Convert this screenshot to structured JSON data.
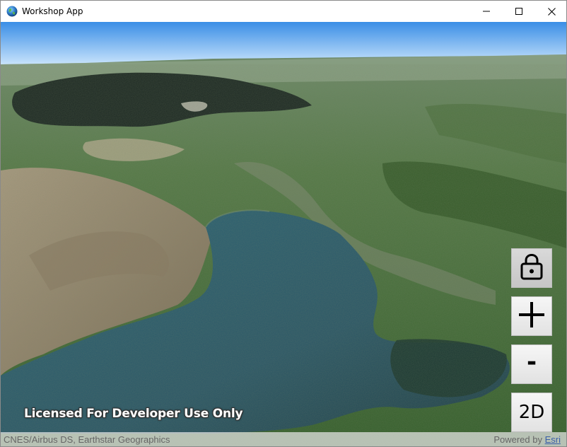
{
  "window": {
    "title": "Workshop App",
    "controls": {
      "minimize_icon": "minimize-icon",
      "maximize_icon": "maximize-icon",
      "close_icon": "close-icon"
    }
  },
  "map": {
    "watermark": "Licensed For Developer Use Only",
    "attribution": "CNES/Airbus DS, Earthstar Geographics",
    "powered_by_prefix": "Powered by",
    "powered_by_link": "Esri",
    "controls": {
      "lock_icon": "lock-icon",
      "zoom_in_icon": "plus-icon",
      "zoom_out_label": "-",
      "view_mode_label": "2D"
    }
  },
  "colors": {
    "sky_top": "#3a8ee6",
    "sky_bottom": "#dff1ff",
    "lake": "#2f5c6e",
    "vegetation": "#3f6a32"
  }
}
